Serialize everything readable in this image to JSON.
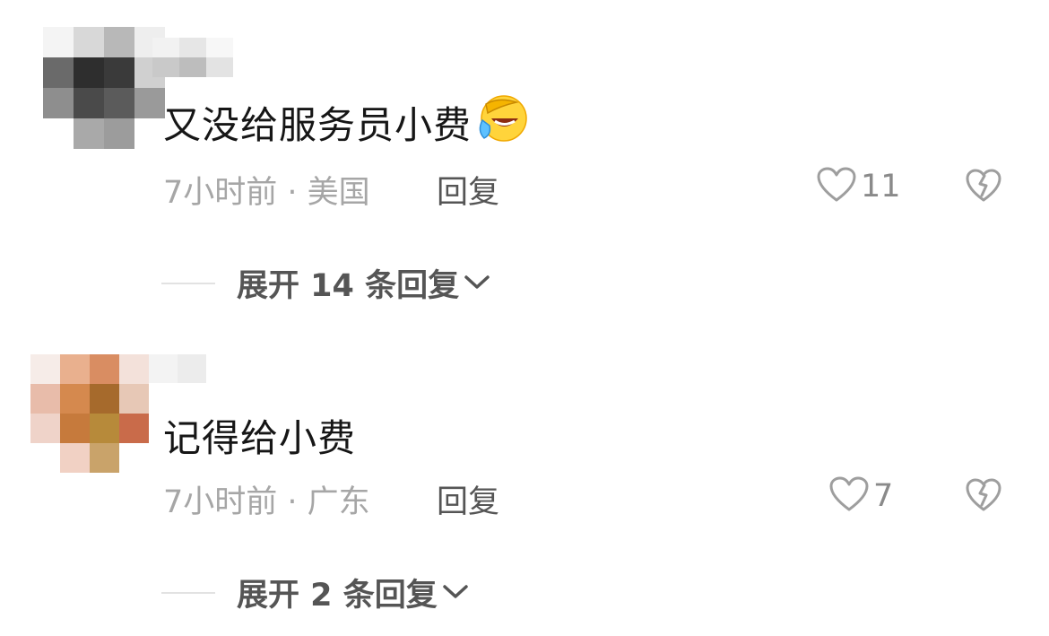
{
  "comments": [
    {
      "text": "又没给服务员小费",
      "emoji": "face-with-hand-over-eye-crying",
      "time": "7小时前",
      "separator": " · ",
      "location": "美国",
      "reply_label": "回复",
      "likes": "11",
      "expand_label": "展开 14 条回复",
      "avatar_pixels": [
        "#f4f4f4",
        "#d8d8d8",
        "#b8b8b8",
        "#eeeeee",
        "#6a6a6a",
        "#2e2e2e",
        "#3a3a3a",
        "#d0d0d0",
        "#8e8e8e",
        "#4a4a4a",
        "#5b5b5b",
        "#9a9a9a",
        "#ffffff",
        "#a9a9a9",
        "#9c9c9c",
        "#ffffff"
      ],
      "name_pixels": [
        "#f2f2f2",
        "#e6e6e6",
        "#f7f7f7",
        "#c9c9c9",
        "#bdbdbd",
        "#e3e3e3"
      ]
    },
    {
      "text": "记得给小费",
      "time": "7小时前",
      "separator": " · ",
      "location": "广东",
      "reply_label": "回复",
      "likes": "7",
      "expand_label": "展开 2 条回复",
      "avatar_pixels": [
        "#f6ece8",
        "#e9b08e",
        "#d98d62",
        "#f3e1da",
        "#e8bcaa",
        "#d5894e",
        "#a66a2c",
        "#e7c8b6",
        "#efd3c9",
        "#c67a3c",
        "#b78a3a",
        "#c96b4a",
        "#ffffff",
        "#f1d1c4",
        "#c9a36a",
        "#ffffff"
      ],
      "name_pixels": [
        "#f3f3f3",
        "#ececec"
      ]
    }
  ],
  "colors": {
    "text": "#161616",
    "meta": "#a6a6a6",
    "action": "#555555",
    "like_count": "#8a8a8a",
    "icon_stroke": "#9e9e9e",
    "divider": "#e2e2e2"
  }
}
